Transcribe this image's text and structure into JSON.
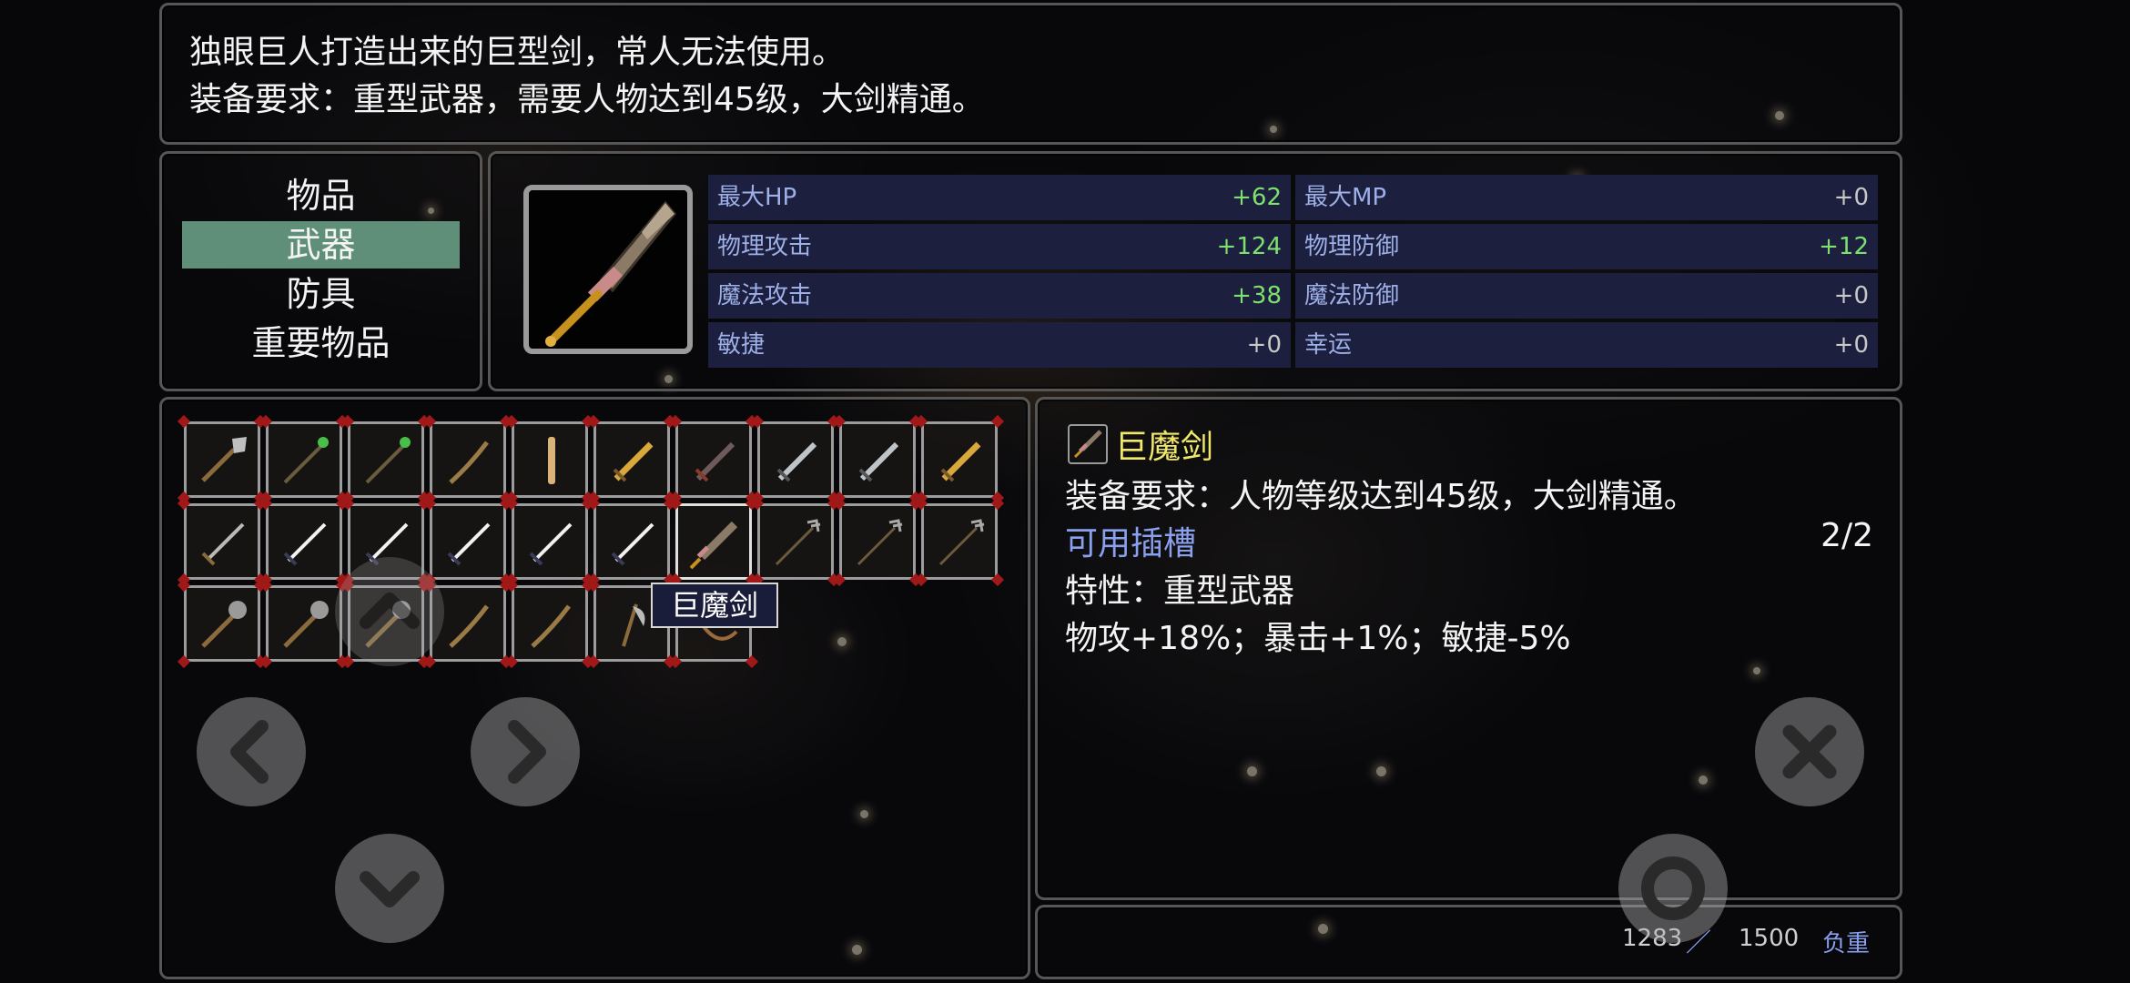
{
  "description": {
    "line1": "独眼巨人打造出来的巨型剑，常人无法使用。",
    "line2": "装备要求：重型武器，需要人物达到45级，大剑精通。"
  },
  "categories": [
    {
      "label": "物品",
      "active": false
    },
    {
      "label": "武器",
      "active": true
    },
    {
      "label": "防具",
      "active": false
    },
    {
      "label": "重要物品",
      "active": false
    }
  ],
  "stats": [
    {
      "label": "最大HP",
      "value": "+62"
    },
    {
      "label": "最大MP",
      "value": "+0"
    },
    {
      "label": "物理攻击",
      "value": "+124"
    },
    {
      "label": "物理防御",
      "value": "+12"
    },
    {
      "label": "魔法攻击",
      "value": "+38"
    },
    {
      "label": "魔法防御",
      "value": "+0"
    },
    {
      "label": "敏捷",
      "value": "+0"
    },
    {
      "label": "幸运",
      "value": "+0"
    }
  ],
  "inventory": {
    "items": [
      "spear",
      "staff-green",
      "staff-green",
      "wooden-staff",
      "bone",
      "golden-sword",
      "dark-sword",
      "steel-sword",
      "steel-sword",
      "golden-sword",
      "sword",
      "white-sword",
      "white-sword",
      "white-sword",
      "white-sword",
      "white-sword",
      "giant-demon-sword",
      "trident",
      "trident",
      "trident",
      "mace",
      "mace",
      "mace",
      "wooden-staff",
      "wooden-staff",
      "axe",
      "bow"
    ],
    "selected_index": 16,
    "tooltip": "巨魔剑"
  },
  "detail": {
    "name": "巨魔剑",
    "requirement": "装备要求：人物等级达到45级，大剑精通。",
    "slots_label": "可用插槽",
    "slots_value": "2/2",
    "trait": "特性：重型武器",
    "bonus": "物攻+18%；暴击+1%；敏捷-5%"
  },
  "weight": {
    "current": "1283",
    "separator": "／",
    "max": "1500",
    "label": "负重"
  },
  "controls": {
    "up": "chevron-up-icon",
    "down": "chevron-down-icon",
    "left": "chevron-left-icon",
    "right": "chevron-right-icon",
    "close": "close-icon",
    "confirm": "circle-icon"
  },
  "colors": {
    "accent_category": "#5f8f78",
    "stat_row": "#1c1f3d",
    "stat_label": "#9db0e8",
    "positive": "#7ee06e",
    "item_name": "#f1e86a",
    "slot_label": "#8aa0ee"
  }
}
